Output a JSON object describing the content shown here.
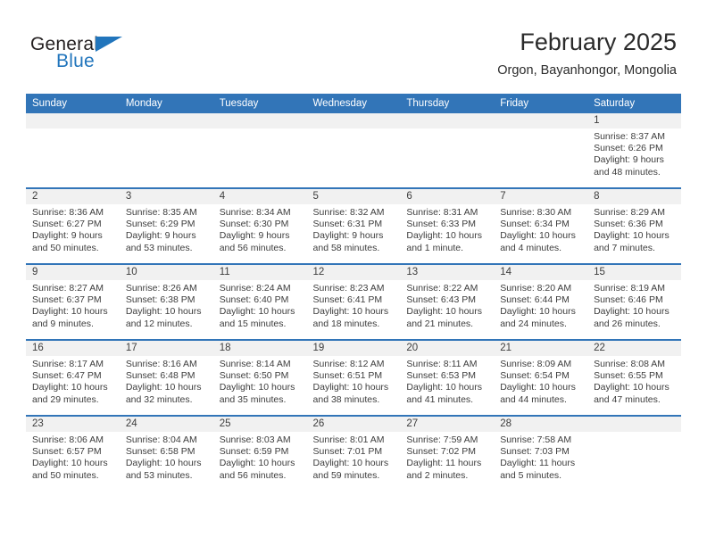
{
  "brand": {
    "name_part1": "General",
    "name_part2": "Blue",
    "triangle_color": "#2175bc",
    "text_color": "#231f20"
  },
  "header": {
    "title": "February 2025",
    "subtitle": "Orgon, Bayanhongor, Mongolia"
  },
  "colors": {
    "header_blue": "#3275b8",
    "daynum_band": "#f1f1f1",
    "text": "#3d3d3d"
  },
  "weekdays": [
    "Sunday",
    "Monday",
    "Tuesday",
    "Wednesday",
    "Thursday",
    "Friday",
    "Saturday"
  ],
  "weeks": [
    [
      {
        "day": "",
        "sunrise": "",
        "sunset": "",
        "daylight_l1": "",
        "daylight_l2": ""
      },
      {
        "day": "",
        "sunrise": "",
        "sunset": "",
        "daylight_l1": "",
        "daylight_l2": ""
      },
      {
        "day": "",
        "sunrise": "",
        "sunset": "",
        "daylight_l1": "",
        "daylight_l2": ""
      },
      {
        "day": "",
        "sunrise": "",
        "sunset": "",
        "daylight_l1": "",
        "daylight_l2": ""
      },
      {
        "day": "",
        "sunrise": "",
        "sunset": "",
        "daylight_l1": "",
        "daylight_l2": ""
      },
      {
        "day": "",
        "sunrise": "",
        "sunset": "",
        "daylight_l1": "",
        "daylight_l2": ""
      },
      {
        "day": "1",
        "sunrise": "Sunrise: 8:37 AM",
        "sunset": "Sunset: 6:26 PM",
        "daylight_l1": "Daylight: 9 hours",
        "daylight_l2": "and 48 minutes."
      }
    ],
    [
      {
        "day": "2",
        "sunrise": "Sunrise: 8:36 AM",
        "sunset": "Sunset: 6:27 PM",
        "daylight_l1": "Daylight: 9 hours",
        "daylight_l2": "and 50 minutes."
      },
      {
        "day": "3",
        "sunrise": "Sunrise: 8:35 AM",
        "sunset": "Sunset: 6:29 PM",
        "daylight_l1": "Daylight: 9 hours",
        "daylight_l2": "and 53 minutes."
      },
      {
        "day": "4",
        "sunrise": "Sunrise: 8:34 AM",
        "sunset": "Sunset: 6:30 PM",
        "daylight_l1": "Daylight: 9 hours",
        "daylight_l2": "and 56 minutes."
      },
      {
        "day": "5",
        "sunrise": "Sunrise: 8:32 AM",
        "sunset": "Sunset: 6:31 PM",
        "daylight_l1": "Daylight: 9 hours",
        "daylight_l2": "and 58 minutes."
      },
      {
        "day": "6",
        "sunrise": "Sunrise: 8:31 AM",
        "sunset": "Sunset: 6:33 PM",
        "daylight_l1": "Daylight: 10 hours",
        "daylight_l2": "and 1 minute."
      },
      {
        "day": "7",
        "sunrise": "Sunrise: 8:30 AM",
        "sunset": "Sunset: 6:34 PM",
        "daylight_l1": "Daylight: 10 hours",
        "daylight_l2": "and 4 minutes."
      },
      {
        "day": "8",
        "sunrise": "Sunrise: 8:29 AM",
        "sunset": "Sunset: 6:36 PM",
        "daylight_l1": "Daylight: 10 hours",
        "daylight_l2": "and 7 minutes."
      }
    ],
    [
      {
        "day": "9",
        "sunrise": "Sunrise: 8:27 AM",
        "sunset": "Sunset: 6:37 PM",
        "daylight_l1": "Daylight: 10 hours",
        "daylight_l2": "and 9 minutes."
      },
      {
        "day": "10",
        "sunrise": "Sunrise: 8:26 AM",
        "sunset": "Sunset: 6:38 PM",
        "daylight_l1": "Daylight: 10 hours",
        "daylight_l2": "and 12 minutes."
      },
      {
        "day": "11",
        "sunrise": "Sunrise: 8:24 AM",
        "sunset": "Sunset: 6:40 PM",
        "daylight_l1": "Daylight: 10 hours",
        "daylight_l2": "and 15 minutes."
      },
      {
        "day": "12",
        "sunrise": "Sunrise: 8:23 AM",
        "sunset": "Sunset: 6:41 PM",
        "daylight_l1": "Daylight: 10 hours",
        "daylight_l2": "and 18 minutes."
      },
      {
        "day": "13",
        "sunrise": "Sunrise: 8:22 AM",
        "sunset": "Sunset: 6:43 PM",
        "daylight_l1": "Daylight: 10 hours",
        "daylight_l2": "and 21 minutes."
      },
      {
        "day": "14",
        "sunrise": "Sunrise: 8:20 AM",
        "sunset": "Sunset: 6:44 PM",
        "daylight_l1": "Daylight: 10 hours",
        "daylight_l2": "and 24 minutes."
      },
      {
        "day": "15",
        "sunrise": "Sunrise: 8:19 AM",
        "sunset": "Sunset: 6:46 PM",
        "daylight_l1": "Daylight: 10 hours",
        "daylight_l2": "and 26 minutes."
      }
    ],
    [
      {
        "day": "16",
        "sunrise": "Sunrise: 8:17 AM",
        "sunset": "Sunset: 6:47 PM",
        "daylight_l1": "Daylight: 10 hours",
        "daylight_l2": "and 29 minutes."
      },
      {
        "day": "17",
        "sunrise": "Sunrise: 8:16 AM",
        "sunset": "Sunset: 6:48 PM",
        "daylight_l1": "Daylight: 10 hours",
        "daylight_l2": "and 32 minutes."
      },
      {
        "day": "18",
        "sunrise": "Sunrise: 8:14 AM",
        "sunset": "Sunset: 6:50 PM",
        "daylight_l1": "Daylight: 10 hours",
        "daylight_l2": "and 35 minutes."
      },
      {
        "day": "19",
        "sunrise": "Sunrise: 8:12 AM",
        "sunset": "Sunset: 6:51 PM",
        "daylight_l1": "Daylight: 10 hours",
        "daylight_l2": "and 38 minutes."
      },
      {
        "day": "20",
        "sunrise": "Sunrise: 8:11 AM",
        "sunset": "Sunset: 6:53 PM",
        "daylight_l1": "Daylight: 10 hours",
        "daylight_l2": "and 41 minutes."
      },
      {
        "day": "21",
        "sunrise": "Sunrise: 8:09 AM",
        "sunset": "Sunset: 6:54 PM",
        "daylight_l1": "Daylight: 10 hours",
        "daylight_l2": "and 44 minutes."
      },
      {
        "day": "22",
        "sunrise": "Sunrise: 8:08 AM",
        "sunset": "Sunset: 6:55 PM",
        "daylight_l1": "Daylight: 10 hours",
        "daylight_l2": "and 47 minutes."
      }
    ],
    [
      {
        "day": "23",
        "sunrise": "Sunrise: 8:06 AM",
        "sunset": "Sunset: 6:57 PM",
        "daylight_l1": "Daylight: 10 hours",
        "daylight_l2": "and 50 minutes."
      },
      {
        "day": "24",
        "sunrise": "Sunrise: 8:04 AM",
        "sunset": "Sunset: 6:58 PM",
        "daylight_l1": "Daylight: 10 hours",
        "daylight_l2": "and 53 minutes."
      },
      {
        "day": "25",
        "sunrise": "Sunrise: 8:03 AM",
        "sunset": "Sunset: 6:59 PM",
        "daylight_l1": "Daylight: 10 hours",
        "daylight_l2": "and 56 minutes."
      },
      {
        "day": "26",
        "sunrise": "Sunrise: 8:01 AM",
        "sunset": "Sunset: 7:01 PM",
        "daylight_l1": "Daylight: 10 hours",
        "daylight_l2": "and 59 minutes."
      },
      {
        "day": "27",
        "sunrise": "Sunrise: 7:59 AM",
        "sunset": "Sunset: 7:02 PM",
        "daylight_l1": "Daylight: 11 hours",
        "daylight_l2": "and 2 minutes."
      },
      {
        "day": "28",
        "sunrise": "Sunrise: 7:58 AM",
        "sunset": "Sunset: 7:03 PM",
        "daylight_l1": "Daylight: 11 hours",
        "daylight_l2": "and 5 minutes."
      },
      {
        "day": "",
        "sunrise": "",
        "sunset": "",
        "daylight_l1": "",
        "daylight_l2": ""
      }
    ]
  ]
}
